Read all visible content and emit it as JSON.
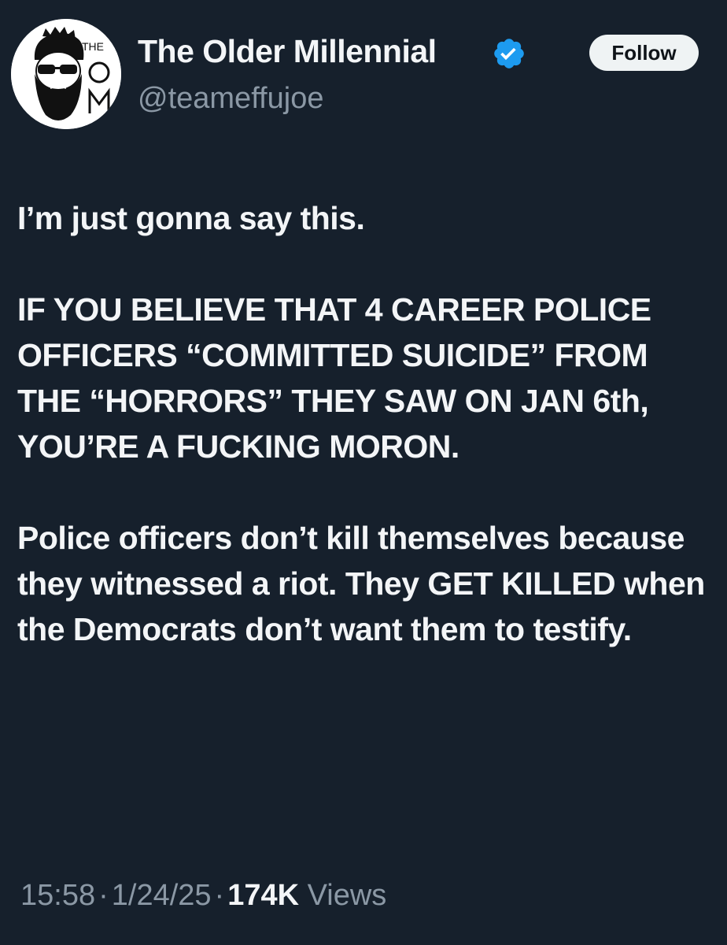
{
  "author": {
    "display_name": "The Older Millennial",
    "handle": "@teameffujoe",
    "avatar_logo_text": "THE OM",
    "verified": true,
    "verified_color": "#1d9bf0"
  },
  "follow_button": {
    "label": "Follow"
  },
  "post": {
    "paragraphs": [
      "I’m just gonna say this.",
      "IF YOU BELIEVE THAT 4 CAREER POLICE OFFICERS “COMMITTED SUICIDE” FROM THE “HORRORS” THEY SAW ON JAN 6th, YOU’RE A FUCKING MORON.",
      "Police officers don’t kill themselves because they witnessed a riot. They GET KILLED when the Democrats don’t want them to testify."
    ]
  },
  "meta": {
    "time": "15:58",
    "separator": "·",
    "date": "1/24/25",
    "views_count": "174K",
    "views_label": "Views"
  },
  "colors": {
    "background": "#16202c",
    "text_primary": "#f3f5f7",
    "text_secondary": "#8b98a5",
    "follow_button_bg": "#eff3f4"
  }
}
